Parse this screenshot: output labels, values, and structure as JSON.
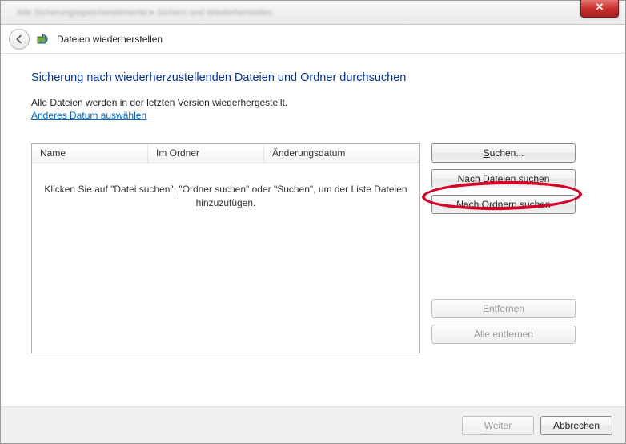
{
  "window": {
    "breadcrumb_blur": "Alle Sicherungsspeicherelemente ▸ Sichern und Wiederherstellen",
    "close": "✕"
  },
  "nav": {
    "title": "Dateien wiederherstellen"
  },
  "page": {
    "heading": "Sicherung nach wiederherzustellenden Dateien und Ordner durchsuchen",
    "subtext": "Alle Dateien werden in der letzten Version wiederhergestellt.",
    "link": "Anderes Datum auswählen"
  },
  "list": {
    "cols": {
      "name": "Name",
      "folder": "Im Ordner",
      "date": "Änderungsdatum"
    },
    "empty": "Klicken Sie auf \"Datei suchen\", \"Ordner suchen\" oder \"Suchen\", um der Liste Dateien hinzuzufügen."
  },
  "buttons": {
    "search_pre": "S",
    "search_post": "uchen...",
    "files_pre": "Nach ",
    "files_u": "D",
    "files_post": "ateien suchen",
    "folders_pre": "Nach ",
    "folders_u": "O",
    "folders_post": "rdnern suchen",
    "remove_pre": "",
    "remove_u": "E",
    "remove_post": "ntfernen",
    "remove_all": "Alle entfernen",
    "next_pre": "",
    "next_u": "W",
    "next_post": "eiter",
    "cancel": "Abbrechen"
  }
}
